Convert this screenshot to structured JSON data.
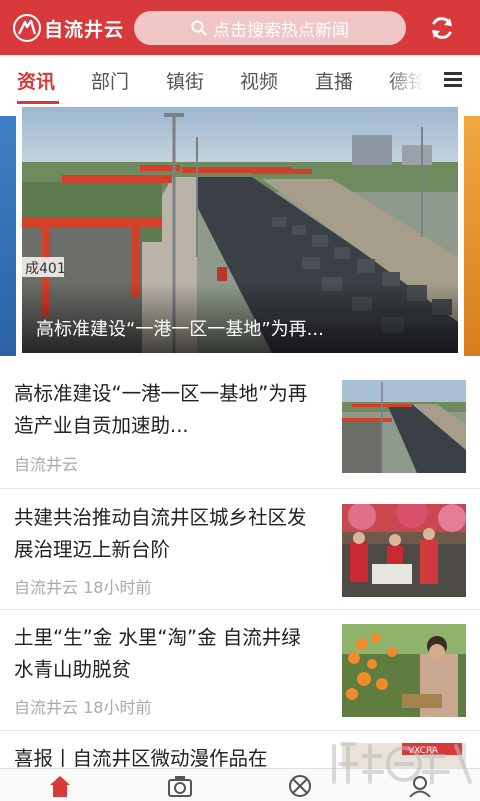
{
  "app": {
    "logo_text": "自流井云",
    "search_placeholder": "点击搜索热点新闻"
  },
  "tabs": [
    {
      "label": "资讯",
      "active": true
    },
    {
      "label": "部门",
      "active": false
    },
    {
      "label": "镇街",
      "active": false
    },
    {
      "label": "视频",
      "active": false
    },
    {
      "label": "直播",
      "active": false
    },
    {
      "label": "德铭",
      "active": false
    }
  ],
  "banner": {
    "caption": "高标准建设“一港一区一基地”为再..."
  },
  "news": [
    {
      "title": "高标准建设“一港一区一基地”为再造产业自贡加速助...",
      "source": "自流井云",
      "time": ""
    },
    {
      "title": "共建共治推动自流井区城乡社区发展治理迈上新台阶",
      "source": "自流井云",
      "time": "18小时前"
    },
    {
      "title": "土里“生”金 水里“淘”金 自流井绿水青山助脱贫",
      "source": "自流井云",
      "time": "18小时前"
    },
    {
      "title": "喜报丨自流井区微动漫作品在",
      "source": "",
      "time": ""
    }
  ],
  "colors": {
    "brand": "#d8393b",
    "tab_active": "#d8393b",
    "meta_text": "#aaaaaa"
  },
  "bottom_nav": [
    {
      "icon": "home-icon",
      "active": true
    },
    {
      "icon": "camera-icon",
      "active": false
    },
    {
      "icon": "discover-icon",
      "active": false
    },
    {
      "icon": "profile-icon",
      "active": false
    }
  ],
  "container_label": "cont2"
}
